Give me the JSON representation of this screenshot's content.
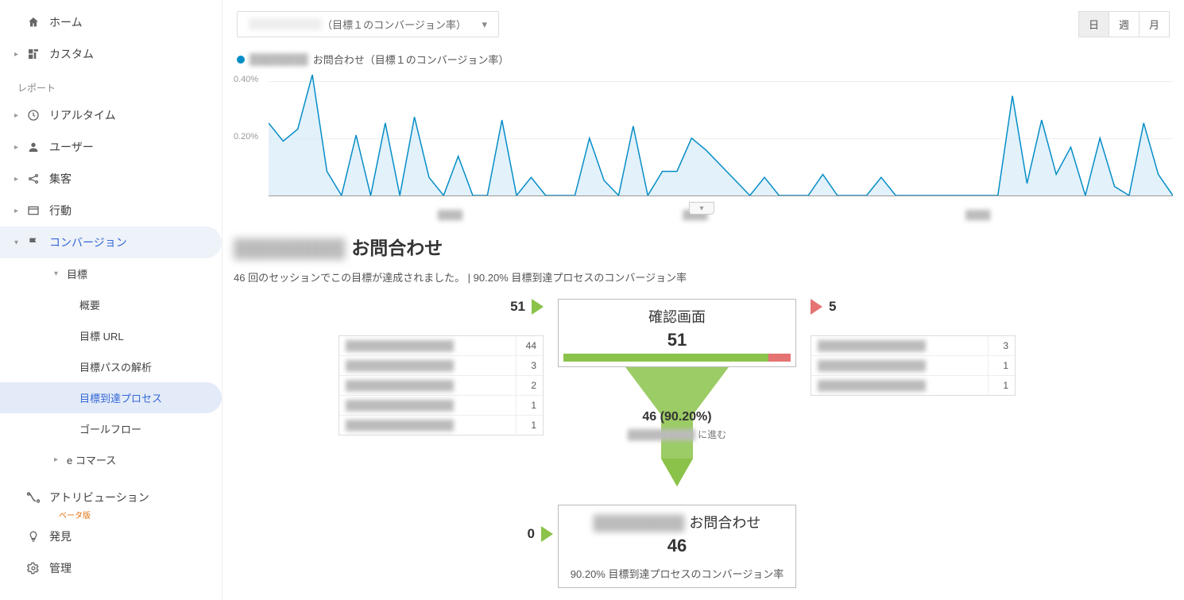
{
  "sidebar": {
    "home": "ホーム",
    "custom": "カスタム",
    "reports_header": "レポート",
    "realtime": "リアルタイム",
    "user": "ユーザー",
    "acquisition": "集客",
    "behavior": "行動",
    "conversions": "コンバージョン",
    "goals": "目標",
    "goal_items": [
      "概要",
      "目標 URL",
      "目標パスの解析",
      "目標到達プロセス",
      "ゴールフロー"
    ],
    "ecommerce": "e コマース",
    "attribution": "アトリビューション",
    "attribution_beta": "ベータ版",
    "discover": "発見",
    "admin": "管理"
  },
  "metric_selector": {
    "blurred": "██████████",
    "label": "（目標１のコンバージョン率）"
  },
  "period": {
    "day": "日",
    "week": "週",
    "month": "月"
  },
  "legend": {
    "blurred": "████████",
    "label": "お問合わせ（目標１のコンバージョン率）"
  },
  "chart_data": {
    "type": "line",
    "title": "お問合わせ（目標１のコンバージョン率）",
    "ylabel": "",
    "ylim": [
      0,
      0.4
    ],
    "yticks": [
      "0.40%",
      "0.20%"
    ],
    "y": [
      0.24,
      0.18,
      0.22,
      0.4,
      0.08,
      0,
      0.2,
      0,
      0.24,
      0,
      0.26,
      0.06,
      0,
      0.13,
      0,
      0,
      0.25,
      0,
      0.06,
      0,
      0,
      0,
      0.19,
      0.05,
      0,
      0.23,
      0,
      0.08,
      0.08,
      0.19,
      0.15,
      0.1,
      0.05,
      0,
      0.06,
      0,
      0,
      0,
      0.07,
      0,
      0,
      0,
      0.06,
      0,
      0,
      0,
      0,
      0,
      0,
      0,
      0,
      0.33,
      0.04,
      0.25,
      0.07,
      0.16,
      0,
      0.19,
      0.03,
      0,
      0.24,
      0.07,
      0
    ]
  },
  "headline": {
    "blurred": "█████████",
    "title": "お問合わせ"
  },
  "subline": "46 回のセッションでこの目標が達成されました。 | 90.20% 目標到達プロセスのコンバージョン率",
  "funnel": {
    "step1": {
      "title": "確認画面",
      "count": "51",
      "in": "51",
      "out": "5",
      "bar_pct": 90.2
    },
    "through": {
      "label": "46 (90.20%)",
      "sub_blur": "██████████",
      "sub_tail": " に進む"
    },
    "step2": {
      "title_blur": "█████████",
      "title": "お問合わせ",
      "count": "46",
      "in": "0",
      "meta": "90.20% 目標到達プロセスのコンバージョン率"
    },
    "entrances": [
      {
        "v": "44"
      },
      {
        "v": "3"
      },
      {
        "v": "2"
      },
      {
        "v": "1"
      },
      {
        "v": "1"
      }
    ],
    "exits": [
      {
        "v": "3"
      },
      {
        "v": "1"
      },
      {
        "v": "1"
      }
    ]
  }
}
